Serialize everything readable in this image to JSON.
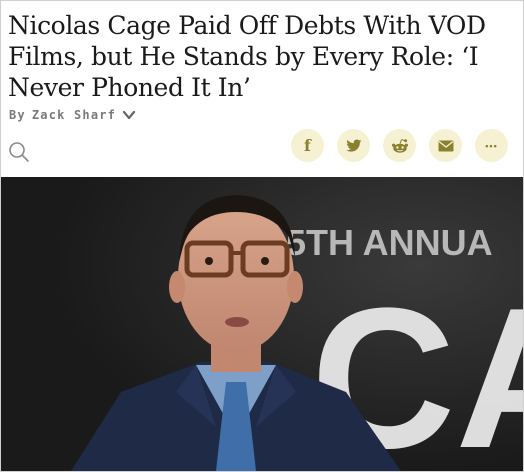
{
  "article": {
    "headline": "Nicolas Cage Paid Off Debts With VOD Films, but He Stands by Every Role: ‘I Never Phoned It In’",
    "byline_prefix": "By",
    "author": "Zack Sharf"
  },
  "share": {
    "facebook": "f",
    "more": "•••"
  },
  "hero": {
    "backdrop_text": "5TH ANNUA",
    "backdrop_letters": "CA"
  },
  "icons": [
    "search-icon",
    "chevron-down-icon",
    "facebook-icon",
    "twitter-icon",
    "reddit-icon",
    "email-icon",
    "more-icon"
  ],
  "colors": {
    "share_bg": "#f6f1d2",
    "share_fg": "#8a8130",
    "headline": "#1a1a1a",
    "byline": "#7a7a7a"
  }
}
